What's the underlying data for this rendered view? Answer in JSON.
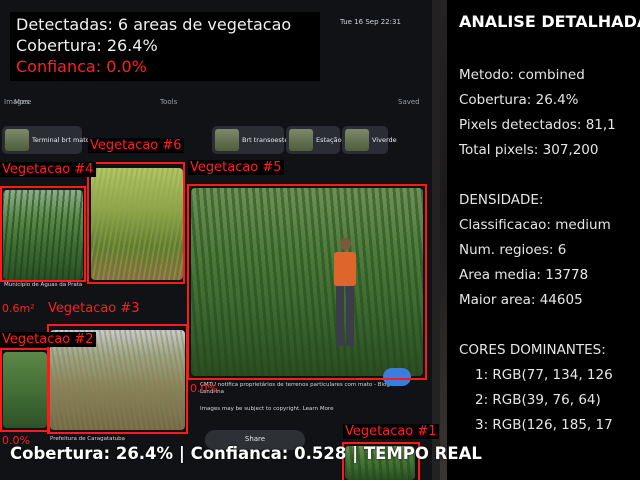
{
  "info_panel": {
    "detected": "Detectadas: 6 areas de vegetacao",
    "coverage": "Cobertura: 26.4%",
    "confidence": "Confianca: 0.0%"
  },
  "analysis": {
    "title": "ANALISE DETALHADA",
    "method": "Metodo: combined",
    "coverage": "Cobertura: 26.4%",
    "pixels_detected": "Pixels detectados: 81,1",
    "total_pixels": "Total pixels: 307,200",
    "density_header": "DENSIDADE:",
    "classification": "Classificacao: medium",
    "num_regions": "Num. regioes: 6",
    "mean_area": "Area media: 13778",
    "max_area": "Maior area: 44605",
    "colors_header": "CORES DOMINANTES:",
    "colors": [
      "1: RGB(77, 134, 126",
      "2: RGB(39, 76, 64)",
      "3: RGB(126, 185, 17"
    ]
  },
  "bottom_status": "Cobertura: 26.4% | Confianca: 0.528 | TEMPO REAL",
  "detections": {
    "v1": "Vegetacao #1",
    "v2": "Vegetacao #2",
    "v3": "Vegetacao #3",
    "v4": "Vegetacao #4",
    "v5": "Vegetacao #5",
    "v6": "Vegetacao #6",
    "pct_a": "0.6m²",
    "pct_b": "0.0%",
    "pct_c": "0.0%"
  },
  "background_ui": {
    "time": "Tue 16 Sep 22:31",
    "images": "Images",
    "more": "More",
    "tools": "Tools",
    "saved": "Saved",
    "chips": [
      "Terminal brt mato",
      "Brt transoeste",
      "Estação brt",
      "Viverde"
    ],
    "caption1": "Município de Águas da Prata",
    "caption2": "Prefeitura de Caragatatuba",
    "caption3": "CMTU notifica proprietários de terrenos particulares com mato - Blog Londrina",
    "caption4": "Images may be subject to copyright. Learn More",
    "share": "Share",
    "colors": {
      "frame_accent": "#ff1a1a",
      "panel_bg": "#000000"
    }
  }
}
